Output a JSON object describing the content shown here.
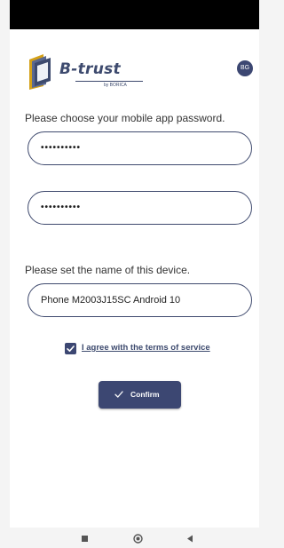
{
  "header": {
    "logo_text": "B-trust",
    "logo_sub": "by BORICA",
    "lang_badge": "BG"
  },
  "password": {
    "label": "Please choose your mobile app password.",
    "value": "••••••••••",
    "confirm_value": "••••••••••"
  },
  "device": {
    "label": "Please set the name of this device.",
    "value": "Phone M2003J15SC Android 10"
  },
  "terms": {
    "checked": true,
    "label": "I agree with the terms of service"
  },
  "confirm": {
    "label": "Confirm",
    "icon": "check-icon"
  },
  "navbar": {
    "icons": [
      "recents-icon",
      "home-icon",
      "back-icon"
    ]
  },
  "colors": {
    "primary": "#3c4772",
    "logo_gold": "#d4a017",
    "status_bar": "#000000"
  }
}
